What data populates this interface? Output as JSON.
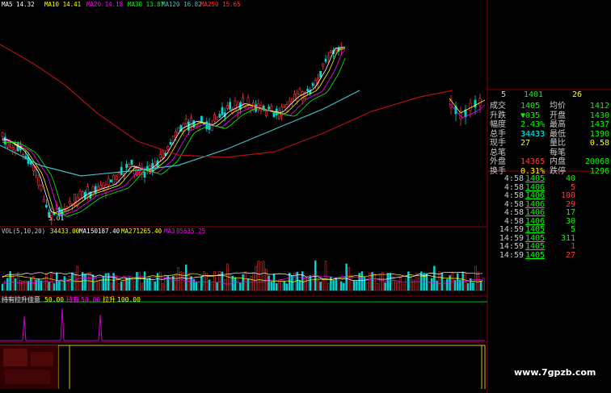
{
  "colors": {
    "background": "#000000",
    "panel_border": "#8b0000",
    "up": "#ff3b3b",
    "down": "#00d4d4",
    "ma5": "#ffffff",
    "ma10": "#ffff00",
    "ma20": "#ff00ff",
    "ma30": "#00ff00",
    "ma120": "#40c0c0",
    "ma250": "#b01010",
    "indicator_line": "#cc00cc",
    "indicator_base": "#d8c000"
  },
  "ma_legend": [
    {
      "label": "MA5",
      "value": "14.32",
      "color": "#ffffff"
    },
    {
      "label": "MA10",
      "value": "14.41",
      "color": "#ffff00"
    },
    {
      "label": "MA20",
      "value": "14.18",
      "color": "#ff00ff"
    },
    {
      "label": "MA30",
      "value": "13.87",
      "color": "#00ff00"
    },
    {
      "label": "MA120",
      "value": "16.82",
      "color": "#40c0c0"
    },
    {
      "label": "MA250",
      "value": "15.65",
      "color": "#ff3030"
    }
  ],
  "price_chart": {
    "low_label": "5.01"
  },
  "volume_legend": {
    "title": "VOL(5,10,20)",
    "vol": "34433.00",
    "ma1_label": "MA1",
    "ma1": "50187.40",
    "ma2_label": "MA2",
    "ma2": "71265.40",
    "ma3_label": "MA3",
    "ma3": "85635.25"
  },
  "indicator_legend": {
    "title": "持有拉升佳意",
    "v1": "50.00",
    "label2": "持有",
    "v2": "50.00",
    "label3": "拉升",
    "v3": "100.00"
  },
  "quote": {
    "header_left": "5",
    "header_mid": "1401",
    "header_right": "26",
    "rows": [
      {
        "l": "成交",
        "lv": "1405",
        "r": "均价",
        "rv": "1412",
        "lvc": "#00ff00",
        "rvc": "#00ff00"
      },
      {
        "l": "升跌",
        "lv": "▼035",
        "r": "开盘",
        "rv": "1430",
        "lvc": "#00ff00",
        "rvc": "#00ff00"
      },
      {
        "l": "幅度",
        "lv": "2.43%",
        "r": "最高",
        "rv": "1437",
        "lvc": "#00ff00",
        "rvc": "#00ff00"
      },
      {
        "l": "总手",
        "lv": "34433",
        "r": "最低",
        "rv": "1390",
        "lvc": "#00ffff",
        "rvc": "#00ff00"
      },
      {
        "l": "现手",
        "lv": "27",
        "r": "量比",
        "rv": "0.58",
        "lvc": "#ffff00",
        "rvc": "#ffff00"
      },
      {
        "l": "总笔",
        "lv": "",
        "r": "每笔",
        "rv": "",
        "lvc": "#ffff00",
        "rvc": "#ffff00"
      },
      {
        "l": "外盘",
        "lv": "14365",
        "r": "内盘",
        "rv": "20068",
        "lvc": "#ff3b3b",
        "rvc": "#00ff00"
      },
      {
        "l": "换手",
        "lv": "0.31%",
        "r": "跌停",
        "rv": "1296",
        "lvc": "#ffff00",
        "rvc": "#00ff00"
      }
    ]
  },
  "ticks": [
    {
      "time": "4:58",
      "price": "1405",
      "vol": "40"
    },
    {
      "time": "4:58",
      "price": "1406",
      "vol": "5"
    },
    {
      "time": "4:58",
      "price": "1406",
      "vol": "100"
    },
    {
      "time": "4:58",
      "price": "1406",
      "vol": "29"
    },
    {
      "time": "4:58",
      "price": "1406",
      "vol": "17"
    },
    {
      "time": "4:58",
      "price": "1406",
      "vol": "30"
    },
    {
      "time": "14:59",
      "price": "1405",
      "vol": "5"
    },
    {
      "time": "14:59",
      "price": "1405",
      "vol": "311"
    },
    {
      "time": "14:59",
      "price": "1405",
      "vol": "1"
    },
    {
      "time": "14:59",
      "price": "1405",
      "vol": "27"
    }
  ],
  "tick_vol_colors": [
    "#00ff00",
    "#ff3b3b",
    "#ff3b3b",
    "#ff3b3b",
    "#00ff00",
    "#00ff00",
    "#00ff00",
    "#00ff00",
    "#ff3b3b",
    "#ff3b3b"
  ],
  "watermark": "www.7gpzb.com"
}
